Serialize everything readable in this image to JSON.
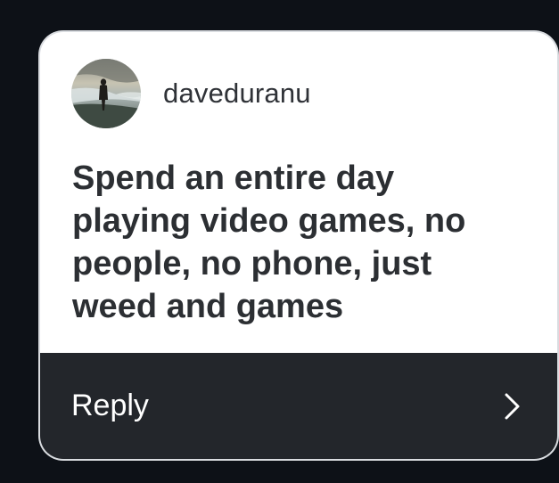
{
  "card": {
    "username": "daveduranu",
    "message": "Spend an entire day playing video games, no people, no phone, just weed and games",
    "reply_label": "Reply"
  },
  "icons": {
    "avatar": "profile-photo-beach-icon",
    "chevron": "chevron-right-icon"
  },
  "colors": {
    "page_background": "#0d1117",
    "card_background": "#ffffff",
    "reply_bar_background": "#23262b",
    "text_dark": "#2c2f33",
    "text_light": "#ffffff"
  }
}
